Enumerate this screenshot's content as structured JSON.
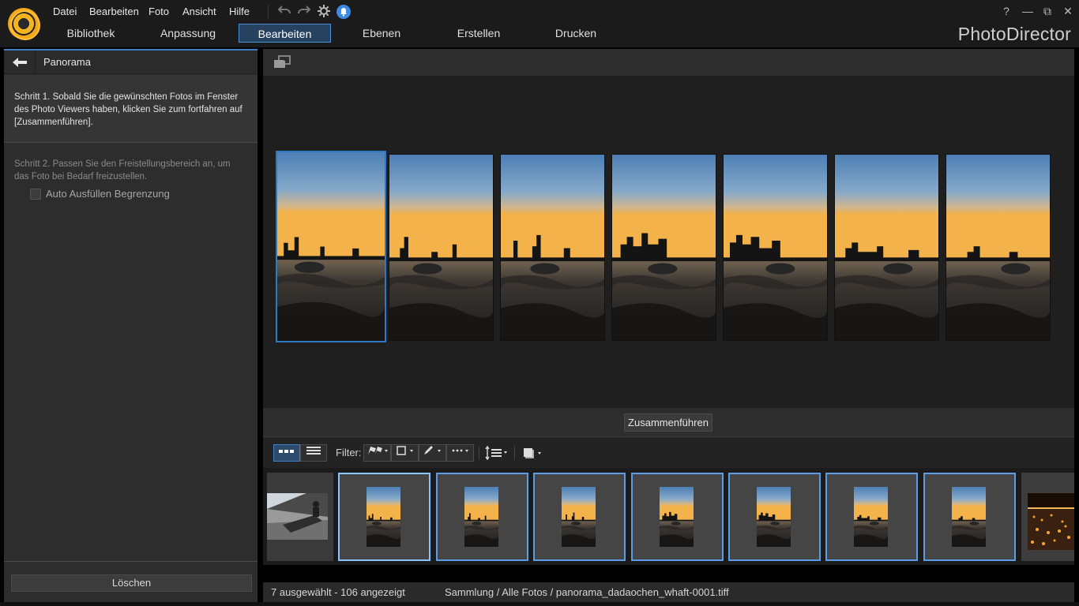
{
  "app": {
    "brand": "PhotoDirector",
    "menu": [
      "Datei",
      "Bearbeiten",
      "Foto",
      "Ansicht",
      "Hilfe"
    ],
    "tabs": [
      "Bibliothek",
      "Anpassung",
      "Bearbeiten",
      "Ebenen",
      "Erstellen",
      "Drucken"
    ],
    "active_tab": "Bearbeiten",
    "window_controls": {
      "help": "?",
      "minimize": "—",
      "restore": "⧉",
      "close": "✕"
    }
  },
  "panel": {
    "title": "Panorama",
    "step1": "Schritt 1. Sobald Sie die gewünschten Fotos im Fenster des Photo Viewers haben, klicken Sie zum fortfahren auf [Zusammenführen].",
    "step2": "Schritt 2. Passen Sie den Freistellungsbereich an, um das Foto bei Bedarf freizustellen.",
    "auto_fill_label": "Auto Ausfüllen Begrenzung",
    "auto_fill_checked": false,
    "delete_label": "Löschen"
  },
  "viewer": {
    "merge_label": "Zusammenführen",
    "photos_count": 7,
    "selected_index": 0
  },
  "filter": {
    "label": "Filter:"
  },
  "status": {
    "selection": "7 ausgewählt - 106 angezeigt",
    "path": "Sammlung / Alle Fotos / panorama_dadaochen_whaft-0001.tiff"
  },
  "colors": {
    "accent": "#3f7fc5",
    "selection_border": "#5a9de6",
    "logo_orange": "#f4b421"
  },
  "icons": [
    "undo-icon",
    "redo-icon",
    "settings-icon",
    "notification-icon",
    "back-arrow-icon",
    "compare-view-icon",
    "grid-view-icon",
    "list-view-icon",
    "flag-filter-icon",
    "color-label-filter-icon",
    "edit-filter-icon",
    "more-filter-icon",
    "sort-icon",
    "stack-icon",
    "scroll-left-icon",
    "scroll-right-icon"
  ]
}
